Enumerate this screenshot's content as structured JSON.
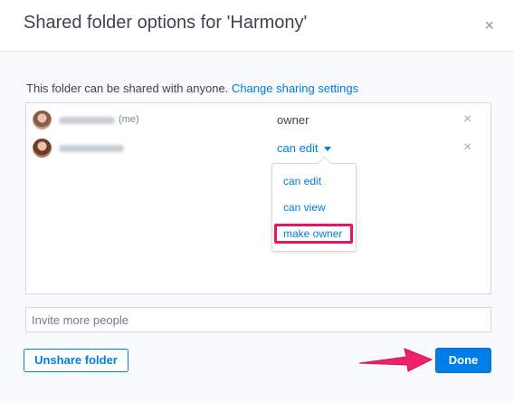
{
  "dialog": {
    "title": "Shared folder options for 'Harmony'",
    "close_icon": "close-icon",
    "close_glyph": "×"
  },
  "info": {
    "text": "This folder can be shared with anyone.",
    "link": "Change sharing settings"
  },
  "members": [
    {
      "name": "",
      "name_blurred": true,
      "me_tag": "(me)",
      "role": "owner",
      "avatar_icon": "avatar",
      "remove_icon": "remove-icon",
      "remove_glyph": "×"
    },
    {
      "name": "",
      "name_blurred": true,
      "role": "can edit",
      "role_is_dropdown": true,
      "avatar_icon": "avatar",
      "remove_icon": "remove-icon",
      "remove_glyph": "×"
    }
  ],
  "dropdown": {
    "items": [
      {
        "label": "can edit"
      },
      {
        "label": "can view"
      },
      {
        "label": "make owner",
        "highlighted": true
      }
    ]
  },
  "invite": {
    "placeholder": "Invite more people",
    "value": ""
  },
  "buttons": {
    "unshare": "Unshare folder",
    "done": "Done"
  },
  "colors": {
    "accent": "#007ee5",
    "highlight": "#e5185f",
    "arrow": "#f0206a",
    "background": "#f7f9fa"
  }
}
